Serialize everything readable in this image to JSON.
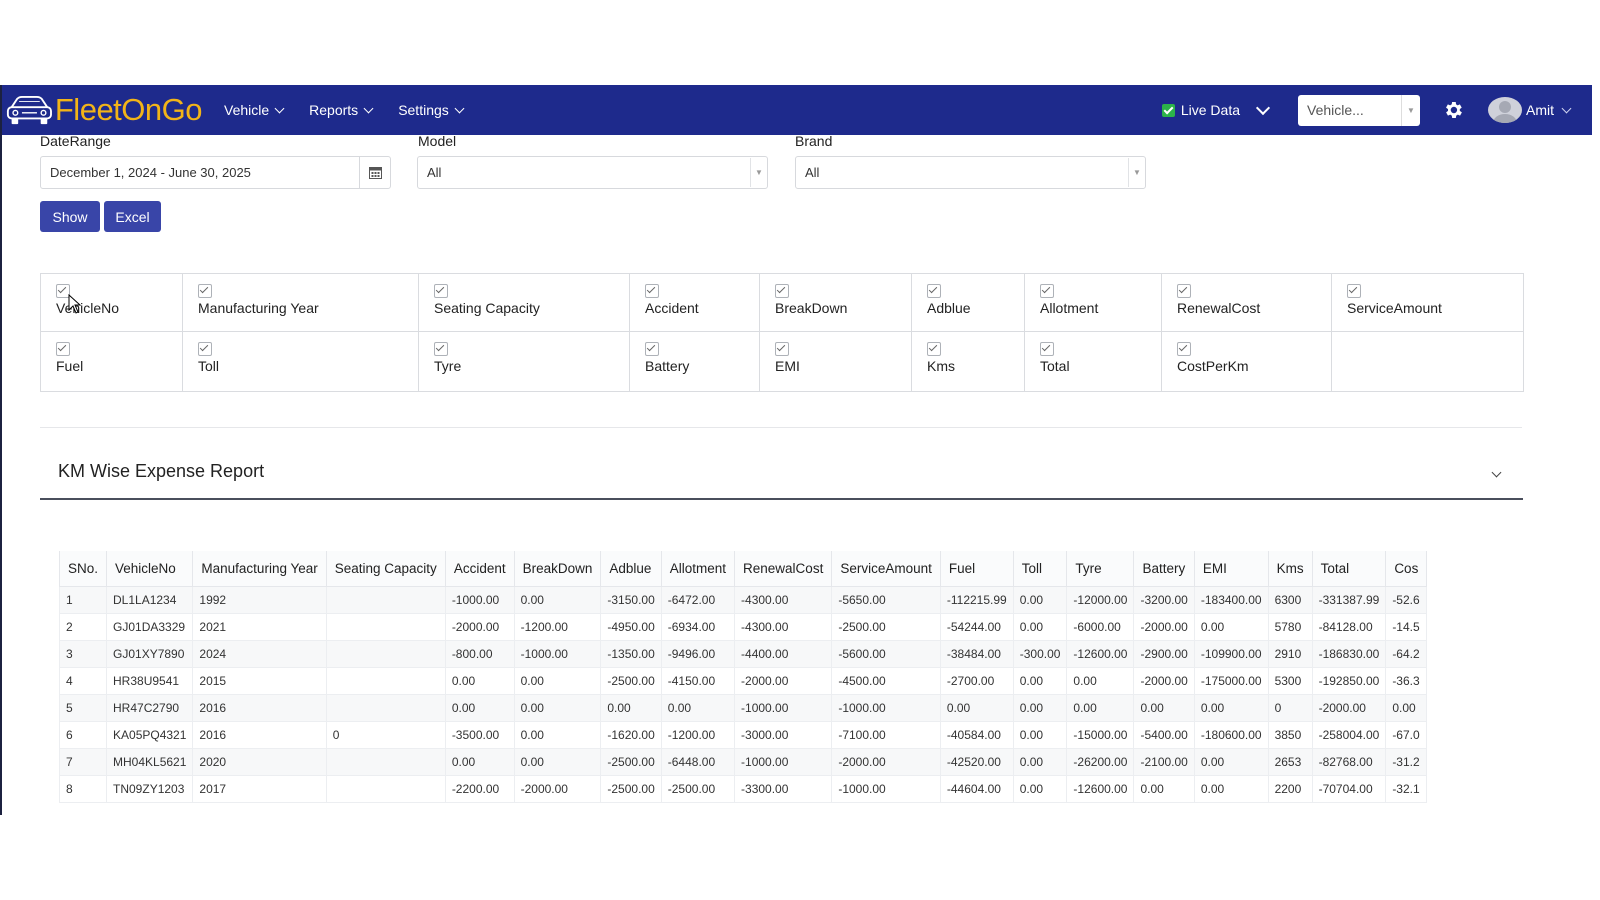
{
  "app": {
    "name": "FleetOnGo"
  },
  "navbar": {
    "menu": [
      "Vehicle",
      "Reports",
      "Settings"
    ],
    "live_data_label": "Live Data",
    "vehicle_select_placeholder": "Vehicle...",
    "user_name": "Amit"
  },
  "filters": {
    "date_range_label": "DateRange",
    "date_range_value": "December 1, 2024 - June 30, 2025",
    "model_label": "Model",
    "model_value": "All",
    "brand_label": "Brand",
    "brand_value": "All",
    "show_button": "Show",
    "excel_button": "Excel"
  },
  "column_toggles": [
    {
      "label": "VehicleNo",
      "checked": true
    },
    {
      "label": "Manufacturing Year",
      "checked": true
    },
    {
      "label": "Seating Capacity",
      "checked": true
    },
    {
      "label": "Accident",
      "checked": true
    },
    {
      "label": "BreakDown",
      "checked": true
    },
    {
      "label": "Adblue",
      "checked": true
    },
    {
      "label": "Allotment",
      "checked": true
    },
    {
      "label": "RenewalCost",
      "checked": true
    },
    {
      "label": "ServiceAmount",
      "checked": true
    },
    {
      "label": "Fuel",
      "checked": true
    },
    {
      "label": "Toll",
      "checked": true
    },
    {
      "label": "Tyre",
      "checked": true
    },
    {
      "label": "Battery",
      "checked": true
    },
    {
      "label": "EMI",
      "checked": true
    },
    {
      "label": "Kms",
      "checked": true
    },
    {
      "label": "Total",
      "checked": true
    },
    {
      "label": "CostPerKm",
      "checked": true
    }
  ],
  "report": {
    "title": "KM Wise Expense Report",
    "columns": [
      "SNo.",
      "VehicleNo",
      "Manufacturing Year",
      "Seating Capacity",
      "Accident",
      "BreakDown",
      "Adblue",
      "Allotment",
      "RenewalCost",
      "ServiceAmount",
      "Fuel",
      "Toll",
      "Tyre",
      "Battery",
      "EMI",
      "Kms",
      "Total",
      "Cos"
    ],
    "rows": [
      [
        "1",
        "DL1LA1234",
        "1992",
        "",
        "-1000.00",
        "0.00",
        "-3150.00",
        "-6472.00",
        "-4300.00",
        "-5650.00",
        "-112215.99",
        "0.00",
        "-12000.00",
        "-3200.00",
        "-183400.00",
        "6300",
        "-331387.99",
        "-52.6"
      ],
      [
        "2",
        "GJ01DA3329",
        "2021",
        "",
        "-2000.00",
        "-1200.00",
        "-4950.00",
        "-6934.00",
        "-4300.00",
        "-2500.00",
        "-54244.00",
        "0.00",
        "-6000.00",
        "-2000.00",
        "0.00",
        "5780",
        "-84128.00",
        "-14.5"
      ],
      [
        "3",
        "GJ01XY7890",
        "2024",
        "",
        "-800.00",
        "-1000.00",
        "-1350.00",
        "-9496.00",
        "-4400.00",
        "-5600.00",
        "-38484.00",
        "-300.00",
        "-12600.00",
        "-2900.00",
        "-109900.00",
        "2910",
        "-186830.00",
        "-64.2"
      ],
      [
        "4",
        "HR38U9541",
        "2015",
        "",
        "0.00",
        "0.00",
        "-2500.00",
        "-4150.00",
        "-2000.00",
        "-4500.00",
        "-2700.00",
        "0.00",
        "0.00",
        "-2000.00",
        "-175000.00",
        "5300",
        "-192850.00",
        "-36.3"
      ],
      [
        "5",
        "HR47C2790",
        "2016",
        "",
        "0.00",
        "0.00",
        "0.00",
        "0.00",
        "-1000.00",
        "-1000.00",
        "0.00",
        "0.00",
        "0.00",
        "0.00",
        "0.00",
        "0",
        "-2000.00",
        "0.00"
      ],
      [
        "6",
        "KA05PQ4321",
        "2016",
        "0",
        "-3500.00",
        "0.00",
        "-1620.00",
        "-1200.00",
        "-3000.00",
        "-7100.00",
        "-40584.00",
        "0.00",
        "-15000.00",
        "-5400.00",
        "-180600.00",
        "3850",
        "-258004.00",
        "-67.0"
      ],
      [
        "7",
        "MH04KL5621",
        "2020",
        "",
        "0.00",
        "0.00",
        "-2500.00",
        "-6448.00",
        "-1000.00",
        "-2000.00",
        "-42520.00",
        "0.00",
        "-26200.00",
        "-2100.00",
        "0.00",
        "2653",
        "-82768.00",
        "-31.2"
      ],
      [
        "8",
        "TN09ZY1203",
        "2017",
        "",
        "-2200.00",
        "-2000.00",
        "-2500.00",
        "-2500.00",
        "-3300.00",
        "-1000.00",
        "-44604.00",
        "0.00",
        "-12600.00",
        "0.00",
        "0.00",
        "2200",
        "-70704.00",
        "-32.1"
      ]
    ]
  },
  "colors": {
    "navbar_bg": "#1e2a8c",
    "logo_text": "#f2b418",
    "button_bg": "#3945a8",
    "live_checkbox": "#2cb34a"
  },
  "icons": [
    "car-logo-icon",
    "checkbox-icon",
    "chevron-down-icon",
    "calendar-icon",
    "gear-icon",
    "avatar-icon",
    "mouse-cursor-icon"
  ]
}
